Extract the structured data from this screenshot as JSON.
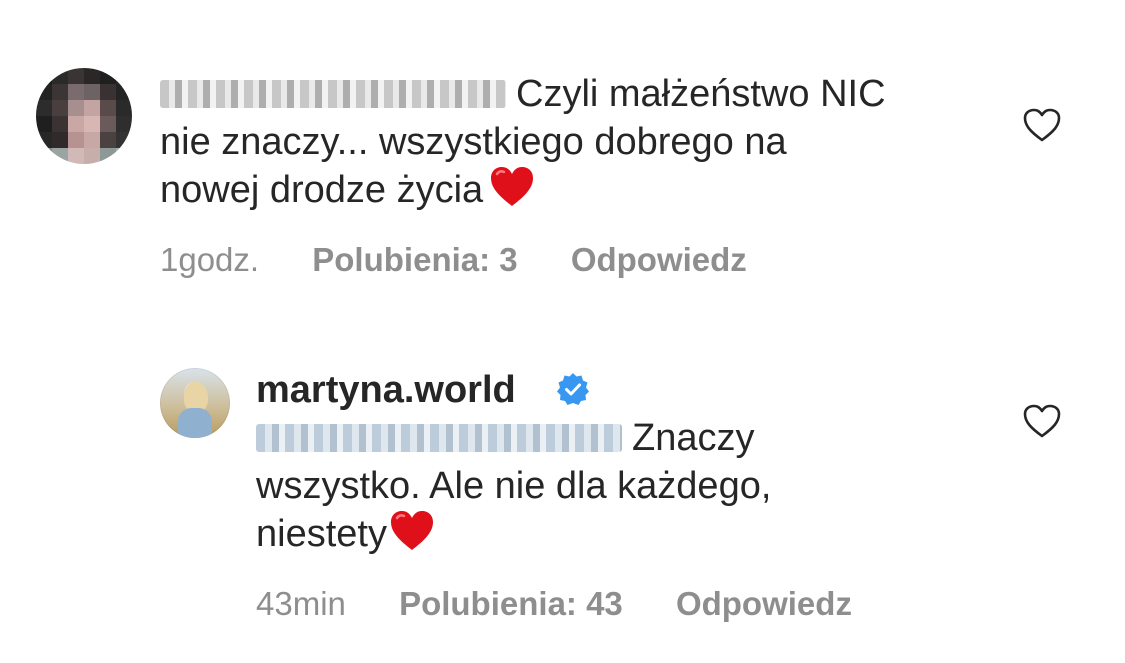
{
  "comments": [
    {
      "username_hidden": true,
      "text": "Czyli małżeństwo NIC nie znaczy... wszystkiego dobrego na nowej drodze życia",
      "line1": "Czyli małżeństwo NIC",
      "line2": "nie znaczy... wszystkiego dobrego na",
      "line3": "nowej drodze życia",
      "emoji": "heart-emoji",
      "time": "1godz.",
      "likes": "Polubienia: 3",
      "reply": "Odpowiedz",
      "like_icon": "heart-outline-icon"
    },
    {
      "username": "martyna.world",
      "verified": true,
      "mention_hidden": true,
      "text": "Znaczy wszystko. Ale nie dla każdego, niestety",
      "line1": "Znaczy",
      "line2": "wszystko. Ale nie dla każdego,",
      "line3": "niestety",
      "emoji": "heart-emoji",
      "time": "43min",
      "likes": "Polubienia: 43",
      "reply": "Odpowiedz",
      "like_icon": "heart-outline-icon"
    }
  ],
  "colors": {
    "text": "#262626",
    "secondary": "#8e8e8e",
    "verified": "#3897f0",
    "heart": "#e0101a"
  }
}
